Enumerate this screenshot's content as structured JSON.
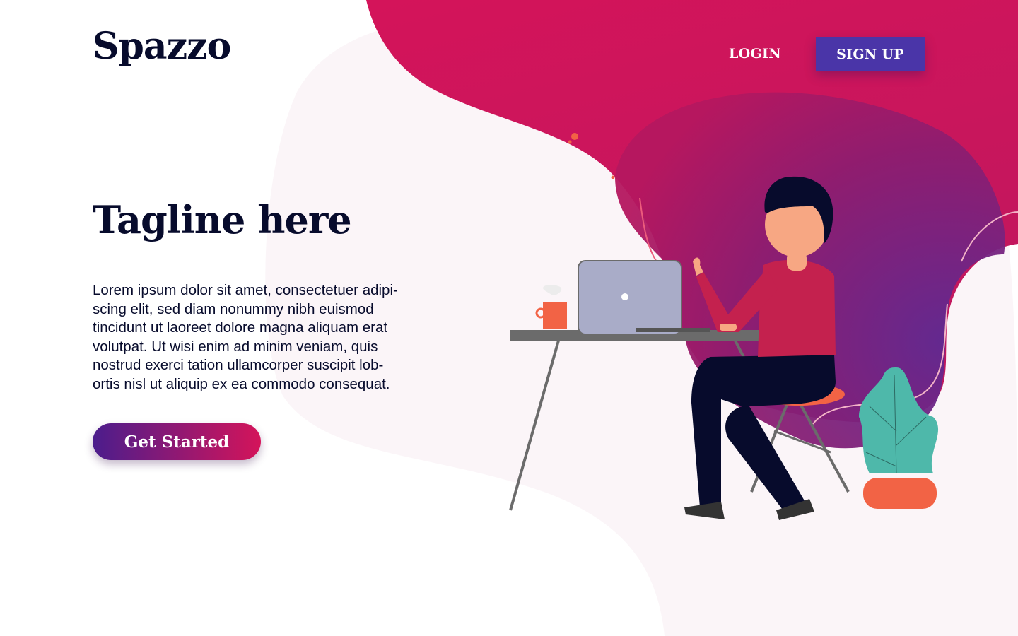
{
  "brand": {
    "logo_text": "Spazzo"
  },
  "nav": {
    "login_label": "LOGIN",
    "signup_label": "SIGN UP"
  },
  "hero": {
    "tagline": "Tagline here",
    "description_lines": [
      "Lorem ipsum dolor sit amet, consectetuer adipi-",
      "scing elit, sed diam nonummy nibh euismod",
      "tincidunt ut laoreet dolore magna aliquam erat",
      "volutpat. Ut wisi enim ad minim veniam, quis",
      "nostrud exerci tation ullamcorper suscipit lob-",
      "ortis nisl ut aliquip ex ea commodo consequat."
    ],
    "cta_label": "Get Started"
  },
  "colors": {
    "text_dark": "#070b2c",
    "accent_pink": "#d4145a",
    "accent_purple": "#662d8c",
    "signup_bg": "#4a35a8",
    "coral": "#f26345",
    "plant_teal": "#4eb8aa",
    "laptop_grey": "#a9acc8",
    "blob_light": "#fbf5f8"
  },
  "illustration": {
    "subject": "person-working-at-laptop-desk",
    "elements": [
      "desk",
      "laptop",
      "coffee-mug",
      "stool",
      "potted-plant",
      "person"
    ]
  }
}
